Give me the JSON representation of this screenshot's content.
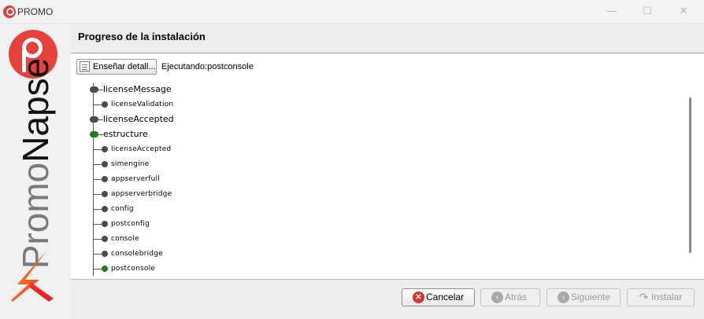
{
  "window": {
    "title": "PROMO",
    "controls": {
      "minimize": "—",
      "maximize": "☐",
      "close": "✕"
    }
  },
  "banner": {
    "brand_line1": "Promo",
    "brand_line2": "Napse"
  },
  "header": {
    "title": "Progreso de la instalación"
  },
  "details": {
    "button_label": "Enseñar detall...",
    "status": "Ejecutando:postconsole"
  },
  "tree": [
    {
      "label": "licenseMessage",
      "level": 0,
      "status": "done"
    },
    {
      "label": "licenseValidation",
      "level": 1,
      "status": "done"
    },
    {
      "label": "licenseAccepted",
      "level": 0,
      "status": "done"
    },
    {
      "label": "estructure",
      "level": 0,
      "status": "active"
    },
    {
      "label": "licenseAccepted",
      "level": 1,
      "status": "done"
    },
    {
      "label": "simengine",
      "level": 1,
      "status": "done"
    },
    {
      "label": "appserverfull",
      "level": 1,
      "status": "done"
    },
    {
      "label": "appserverbridge",
      "level": 1,
      "status": "done"
    },
    {
      "label": "config",
      "level": 1,
      "status": "done"
    },
    {
      "label": "postconfig",
      "level": 1,
      "status": "done"
    },
    {
      "label": "console",
      "level": 1,
      "status": "done"
    },
    {
      "label": "consolebridge",
      "level": 1,
      "status": "done"
    },
    {
      "label": "postconsole",
      "level": 1,
      "status": "active"
    }
  ],
  "footer": {
    "cancel": "Cancelar",
    "back": "Atrás",
    "next": "Siguiente",
    "install": "Instalar"
  },
  "colors": {
    "active_node": "#1e7d1e",
    "done_node": "#4a4a4a",
    "brand_red": "#e7413b"
  }
}
